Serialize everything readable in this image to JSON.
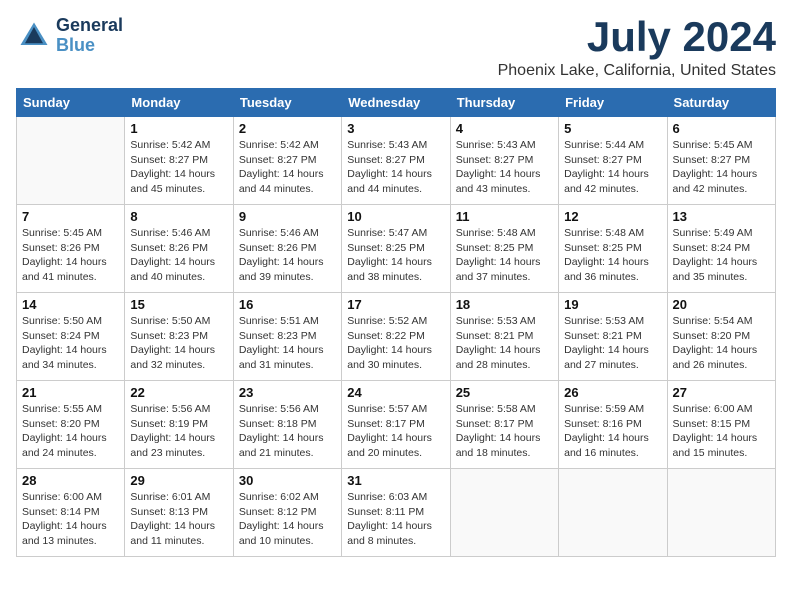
{
  "logo": {
    "line1": "General",
    "line2": "Blue"
  },
  "title": "July 2024",
  "subtitle": "Phoenix Lake, California, United States",
  "days_of_week": [
    "Sunday",
    "Monday",
    "Tuesday",
    "Wednesday",
    "Thursday",
    "Friday",
    "Saturday"
  ],
  "weeks": [
    [
      {
        "day": "",
        "info": ""
      },
      {
        "day": "1",
        "info": "Sunrise: 5:42 AM\nSunset: 8:27 PM\nDaylight: 14 hours\nand 45 minutes."
      },
      {
        "day": "2",
        "info": "Sunrise: 5:42 AM\nSunset: 8:27 PM\nDaylight: 14 hours\nand 44 minutes."
      },
      {
        "day": "3",
        "info": "Sunrise: 5:43 AM\nSunset: 8:27 PM\nDaylight: 14 hours\nand 44 minutes."
      },
      {
        "day": "4",
        "info": "Sunrise: 5:43 AM\nSunset: 8:27 PM\nDaylight: 14 hours\nand 43 minutes."
      },
      {
        "day": "5",
        "info": "Sunrise: 5:44 AM\nSunset: 8:27 PM\nDaylight: 14 hours\nand 42 minutes."
      },
      {
        "day": "6",
        "info": "Sunrise: 5:45 AM\nSunset: 8:27 PM\nDaylight: 14 hours\nand 42 minutes."
      }
    ],
    [
      {
        "day": "7",
        "info": "Sunrise: 5:45 AM\nSunset: 8:26 PM\nDaylight: 14 hours\nand 41 minutes."
      },
      {
        "day": "8",
        "info": "Sunrise: 5:46 AM\nSunset: 8:26 PM\nDaylight: 14 hours\nand 40 minutes."
      },
      {
        "day": "9",
        "info": "Sunrise: 5:46 AM\nSunset: 8:26 PM\nDaylight: 14 hours\nand 39 minutes."
      },
      {
        "day": "10",
        "info": "Sunrise: 5:47 AM\nSunset: 8:25 PM\nDaylight: 14 hours\nand 38 minutes."
      },
      {
        "day": "11",
        "info": "Sunrise: 5:48 AM\nSunset: 8:25 PM\nDaylight: 14 hours\nand 37 minutes."
      },
      {
        "day": "12",
        "info": "Sunrise: 5:48 AM\nSunset: 8:25 PM\nDaylight: 14 hours\nand 36 minutes."
      },
      {
        "day": "13",
        "info": "Sunrise: 5:49 AM\nSunset: 8:24 PM\nDaylight: 14 hours\nand 35 minutes."
      }
    ],
    [
      {
        "day": "14",
        "info": "Sunrise: 5:50 AM\nSunset: 8:24 PM\nDaylight: 14 hours\nand 34 minutes."
      },
      {
        "day": "15",
        "info": "Sunrise: 5:50 AM\nSunset: 8:23 PM\nDaylight: 14 hours\nand 32 minutes."
      },
      {
        "day": "16",
        "info": "Sunrise: 5:51 AM\nSunset: 8:23 PM\nDaylight: 14 hours\nand 31 minutes."
      },
      {
        "day": "17",
        "info": "Sunrise: 5:52 AM\nSunset: 8:22 PM\nDaylight: 14 hours\nand 30 minutes."
      },
      {
        "day": "18",
        "info": "Sunrise: 5:53 AM\nSunset: 8:21 PM\nDaylight: 14 hours\nand 28 minutes."
      },
      {
        "day": "19",
        "info": "Sunrise: 5:53 AM\nSunset: 8:21 PM\nDaylight: 14 hours\nand 27 minutes."
      },
      {
        "day": "20",
        "info": "Sunrise: 5:54 AM\nSunset: 8:20 PM\nDaylight: 14 hours\nand 26 minutes."
      }
    ],
    [
      {
        "day": "21",
        "info": "Sunrise: 5:55 AM\nSunset: 8:20 PM\nDaylight: 14 hours\nand 24 minutes."
      },
      {
        "day": "22",
        "info": "Sunrise: 5:56 AM\nSunset: 8:19 PM\nDaylight: 14 hours\nand 23 minutes."
      },
      {
        "day": "23",
        "info": "Sunrise: 5:56 AM\nSunset: 8:18 PM\nDaylight: 14 hours\nand 21 minutes."
      },
      {
        "day": "24",
        "info": "Sunrise: 5:57 AM\nSunset: 8:17 PM\nDaylight: 14 hours\nand 20 minutes."
      },
      {
        "day": "25",
        "info": "Sunrise: 5:58 AM\nSunset: 8:17 PM\nDaylight: 14 hours\nand 18 minutes."
      },
      {
        "day": "26",
        "info": "Sunrise: 5:59 AM\nSunset: 8:16 PM\nDaylight: 14 hours\nand 16 minutes."
      },
      {
        "day": "27",
        "info": "Sunrise: 6:00 AM\nSunset: 8:15 PM\nDaylight: 14 hours\nand 15 minutes."
      }
    ],
    [
      {
        "day": "28",
        "info": "Sunrise: 6:00 AM\nSunset: 8:14 PM\nDaylight: 14 hours\nand 13 minutes."
      },
      {
        "day": "29",
        "info": "Sunrise: 6:01 AM\nSunset: 8:13 PM\nDaylight: 14 hours\nand 11 minutes."
      },
      {
        "day": "30",
        "info": "Sunrise: 6:02 AM\nSunset: 8:12 PM\nDaylight: 14 hours\nand 10 minutes."
      },
      {
        "day": "31",
        "info": "Sunrise: 6:03 AM\nSunset: 8:11 PM\nDaylight: 14 hours\nand 8 minutes."
      },
      {
        "day": "",
        "info": ""
      },
      {
        "day": "",
        "info": ""
      },
      {
        "day": "",
        "info": ""
      }
    ]
  ]
}
